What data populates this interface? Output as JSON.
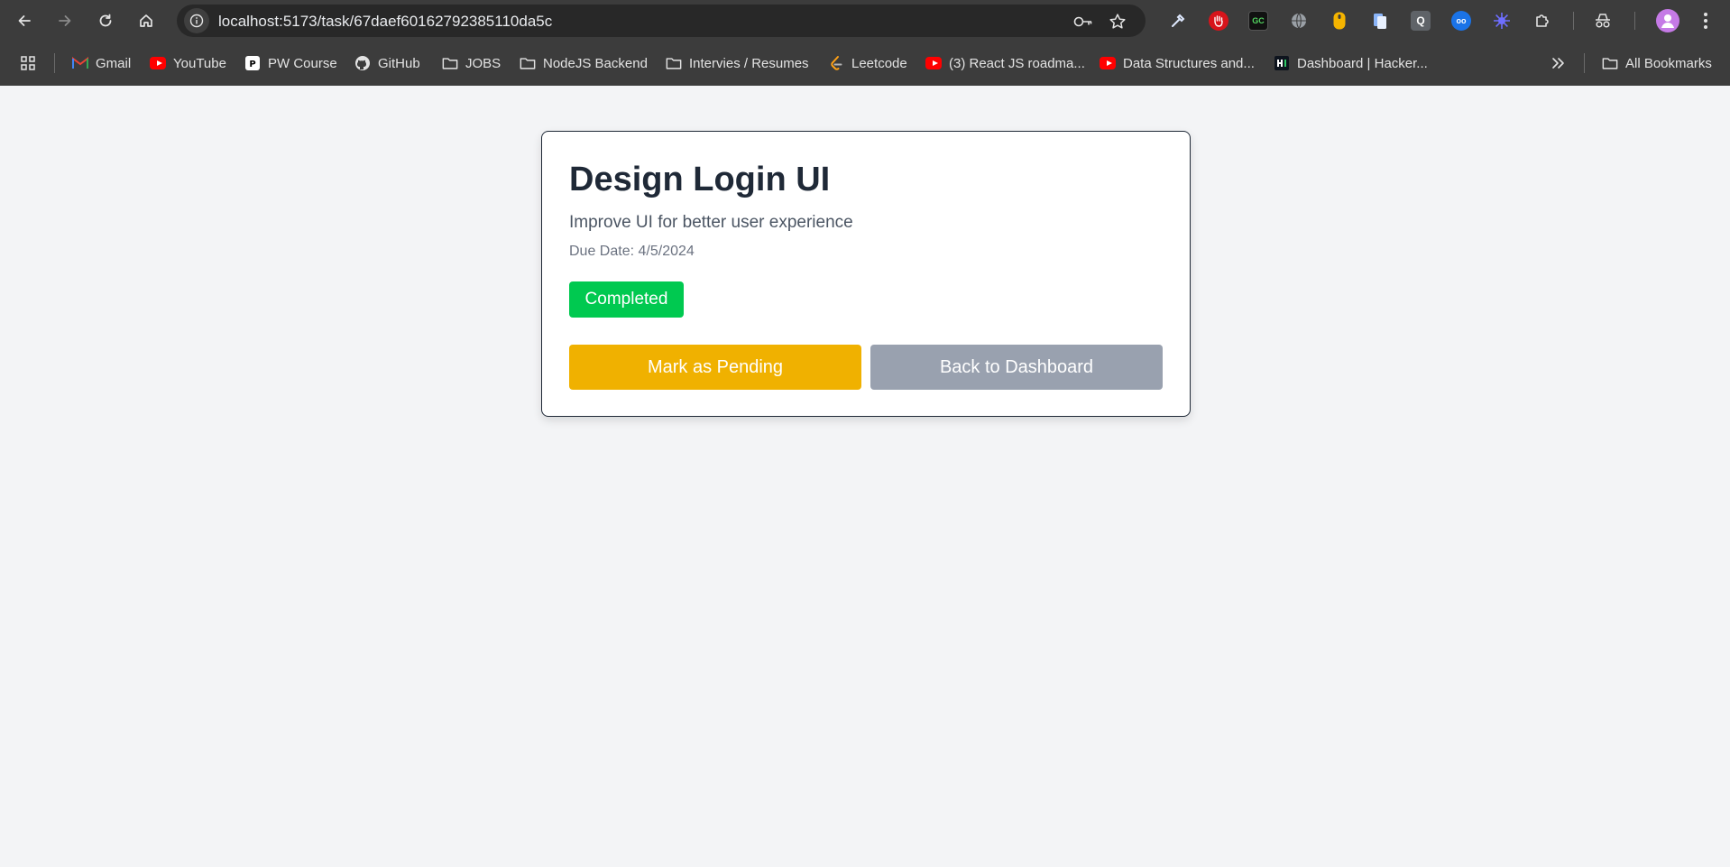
{
  "browser": {
    "url": "localhost:5173/task/67daef60162792385110da5c",
    "bookmarks": [
      {
        "label": "Gmail",
        "icon": "gmail-icon"
      },
      {
        "label": "YouTube",
        "icon": "youtube-icon"
      },
      {
        "label": "PW Course",
        "icon": "pw-icon"
      },
      {
        "label": "GitHub",
        "icon": "github-icon"
      },
      {
        "label": "JOBS",
        "icon": "folder-icon"
      },
      {
        "label": "NodeJS Backend",
        "icon": "folder-icon"
      },
      {
        "label": "Intervies / Resumes",
        "icon": "folder-icon"
      },
      {
        "label": "Leetcode",
        "icon": "leetcode-icon"
      },
      {
        "label": "(3) React JS roadma...",
        "icon": "youtube-icon"
      },
      {
        "label": "Data Structures and...",
        "icon": "youtube-icon"
      },
      {
        "label": "Dashboard | Hacker...",
        "icon": "hackerrank-icon"
      }
    ],
    "all_bookmarks": "All Bookmarks"
  },
  "task": {
    "title": "Design Login UI",
    "description": "Improve UI for better user experience",
    "due_label": "Due Date:",
    "due_date": "4/5/2024",
    "status": "Completed",
    "status_color": "#00c950",
    "mark_button": "Mark as Pending",
    "mark_button_color": "#f0b100",
    "back_button": "Back to Dashboard",
    "back_button_color": "#99a1af"
  }
}
